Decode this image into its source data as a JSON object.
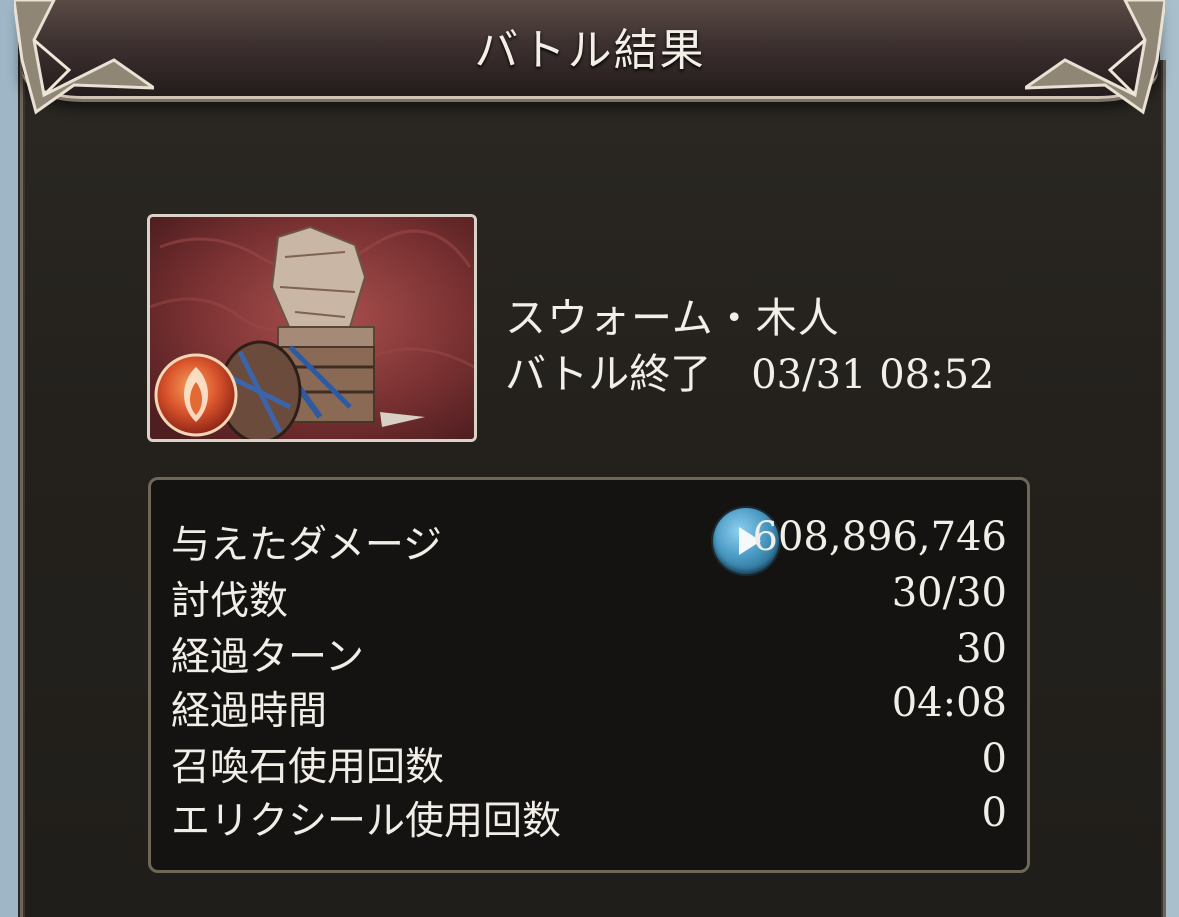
{
  "header": {
    "title": "バトル結果"
  },
  "enemy": {
    "name": "スウォーム・木人",
    "battle_end_label": "バトル終了",
    "battle_end_time": "03/31 08:52",
    "element_icon": "fire-element-icon"
  },
  "stats": [
    {
      "label": "与えたダメージ",
      "value": "608,896,746"
    },
    {
      "label": "討伐数",
      "value": "30/30"
    },
    {
      "label": "経過ターン",
      "value": "30"
    },
    {
      "label": "経過時間",
      "value": "04:08"
    },
    {
      "label": "召喚石使用回数",
      "value": "0"
    },
    {
      "label": "エリクシール使用回数",
      "value": "0"
    }
  ],
  "colors": {
    "panel_bg": "#24211d",
    "header_bg": "#3d3130",
    "stats_bg": "#151311",
    "text": "#f1eee7",
    "play_button": "#4a9ac4",
    "portrait_bg": "#7d3434"
  }
}
